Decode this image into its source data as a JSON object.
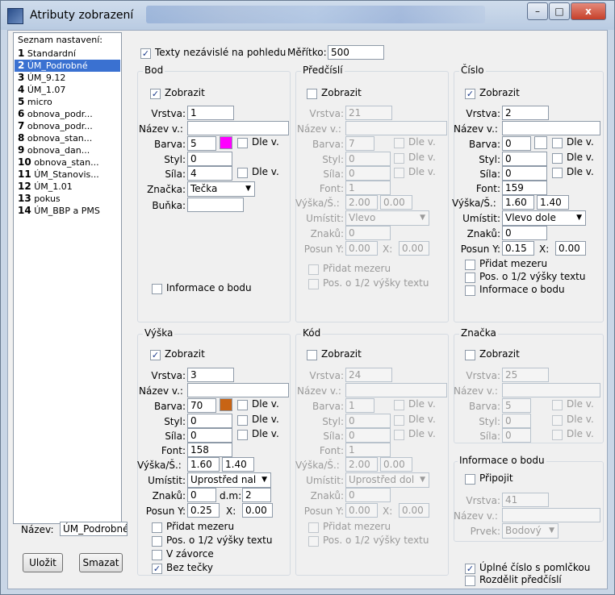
{
  "window": {
    "title": "Atributy zobrazení",
    "minimize": "–",
    "maximize": "□",
    "close": "x"
  },
  "list": {
    "header": "Seznam nastavení:",
    "items": [
      {
        "num": "1",
        "label": "Standardní"
      },
      {
        "num": "2",
        "label": "ÚM_Podrobné"
      },
      {
        "num": "3",
        "label": "ÚM_9.12"
      },
      {
        "num": "4",
        "label": "ÚM_1.07"
      },
      {
        "num": "5",
        "label": "micro"
      },
      {
        "num": "6",
        "label": "obnova_podr..."
      },
      {
        "num": "7",
        "label": "obnova_podr..."
      },
      {
        "num": "8",
        "label": "obnova_stan..."
      },
      {
        "num": "9",
        "label": "obnova_dan..."
      },
      {
        "num": "10",
        "label": "obnova_stan..."
      },
      {
        "num": "11",
        "label": "ÚM_Stanovis..."
      },
      {
        "num": "12",
        "label": "ÚM_1.01"
      },
      {
        "num": "13",
        "label": "pokus"
      },
      {
        "num": "14",
        "label": "ÚM_BBP a PMS"
      }
    ],
    "selected_index": 1
  },
  "top": {
    "texts_label": "Texty nezávislé na pohledu",
    "texts_checked": true,
    "scale_label": "Měřítko:",
    "scale_value": "500"
  },
  "labels": {
    "show": "Zobrazit",
    "layer": "Vrstva:",
    "name": "Název v.:",
    "color": "Barva:",
    "style": "Styl:",
    "weight": "Síla:",
    "by": "Dle v.",
    "symbol": "Značka:",
    "cell": "Buňka:",
    "font": "Font:",
    "hw": "Výška/Š.:",
    "place": "Umístit:",
    "chars": "Znaků:",
    "offset": "Posun Y:",
    "x": "X:",
    "dm": "d.m:",
    "add_space": "Přidat mezeru",
    "half_pos": "Pos. o 1/2 výšky textu",
    "brackets": "V závorce",
    "nodot": "Bez tečky",
    "point_info": "Informace o bodu",
    "attach": "Připojit",
    "element": "Prvek:"
  },
  "bod": {
    "title": "Bod",
    "show": true,
    "layer": "1",
    "name": "",
    "color": "5",
    "swatch": "#ff00ff",
    "style": "0",
    "weight": "4",
    "symbol": "Tečka",
    "cell": "",
    "info_label": "Informace o bodu"
  },
  "predcisli": {
    "title": "Předčíslí",
    "show": false,
    "layer": "21",
    "name": "",
    "color": "7",
    "style": "0",
    "weight": "0",
    "font": "1",
    "h": "2.00",
    "w": "0.00",
    "place": "Vlevo",
    "chars": "0",
    "offy": "0.00",
    "x": "0.00"
  },
  "cislo": {
    "title": "Číslo",
    "show": true,
    "layer": "2",
    "name": "",
    "color": "0",
    "swatch": "#ffffff",
    "style": "0",
    "weight": "0",
    "font": "159",
    "h": "1.60",
    "w": "1.40",
    "place": "Vlevo dole",
    "chars": "0",
    "offy": "0.15",
    "x": "0.00"
  },
  "vyska": {
    "title": "Výška",
    "show": true,
    "layer": "3",
    "name": "",
    "color": "70",
    "swatch": "#c86414",
    "style": "0",
    "weight": "0",
    "font": "158",
    "h": "1.60",
    "w": "1.40",
    "place": "Uprostřed nal",
    "chars": "0",
    "dm": "2",
    "offy": "0.25",
    "x": "0.00",
    "nodot": true
  },
  "kod": {
    "title": "Kód",
    "show": false,
    "layer": "24",
    "name": "",
    "color": "1",
    "style": "0",
    "weight": "0",
    "font": "1",
    "h": "2.00",
    "w": "0.00",
    "place": "Uprostřed dol",
    "chars": "0",
    "offy": "0.00",
    "x": "0.00"
  },
  "znacka": {
    "title": "Značka",
    "show": false,
    "layer": "25",
    "name": "",
    "color": "5",
    "style": "0",
    "weight": "0"
  },
  "info": {
    "title": "Informace o bodu",
    "attach": false,
    "layer": "41",
    "name": "",
    "element": "Bodový"
  },
  "bottom": {
    "full_number": "Úplné číslo s pomlčkou",
    "full_checked": true,
    "split": "Rozdělit předčíslí",
    "split_checked": false
  },
  "name_field": {
    "label": "Název:",
    "value": "ÚM_Podrobné"
  },
  "buttons": {
    "save": "Uložit",
    "delete": "Smazat"
  }
}
